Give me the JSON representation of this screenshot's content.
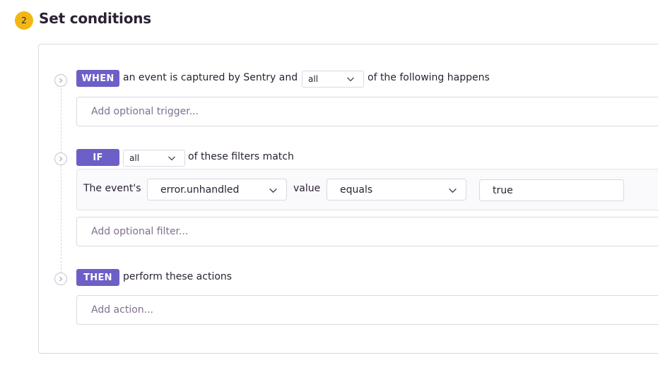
{
  "header": {
    "step_number": "2",
    "title": "Set conditions"
  },
  "when": {
    "tag": "WHEN",
    "text_before": "an event is captured by Sentry and",
    "match_select": "all",
    "text_after": "of the following happens",
    "add_trigger_placeholder": "Add optional trigger..."
  },
  "if": {
    "tag": "IF",
    "match_select": "all",
    "text_after": "of these filters match",
    "filter": {
      "label": "The event's",
      "attribute": "error.unhandled",
      "value_label": "value",
      "operator": "equals",
      "value": "true"
    },
    "add_filter_placeholder": "Add optional filter..."
  },
  "then": {
    "tag": "THEN",
    "text_after": "perform these actions",
    "add_action_placeholder": "Add action..."
  },
  "icons": {
    "step_icon": "chevron-right-circle-icon",
    "select_icon": "chevron-down-icon"
  },
  "colors": {
    "accent": "#6c5fc7",
    "badge": "#f2b712",
    "border": "#dcd7e2",
    "placeholder": "#80708f"
  }
}
